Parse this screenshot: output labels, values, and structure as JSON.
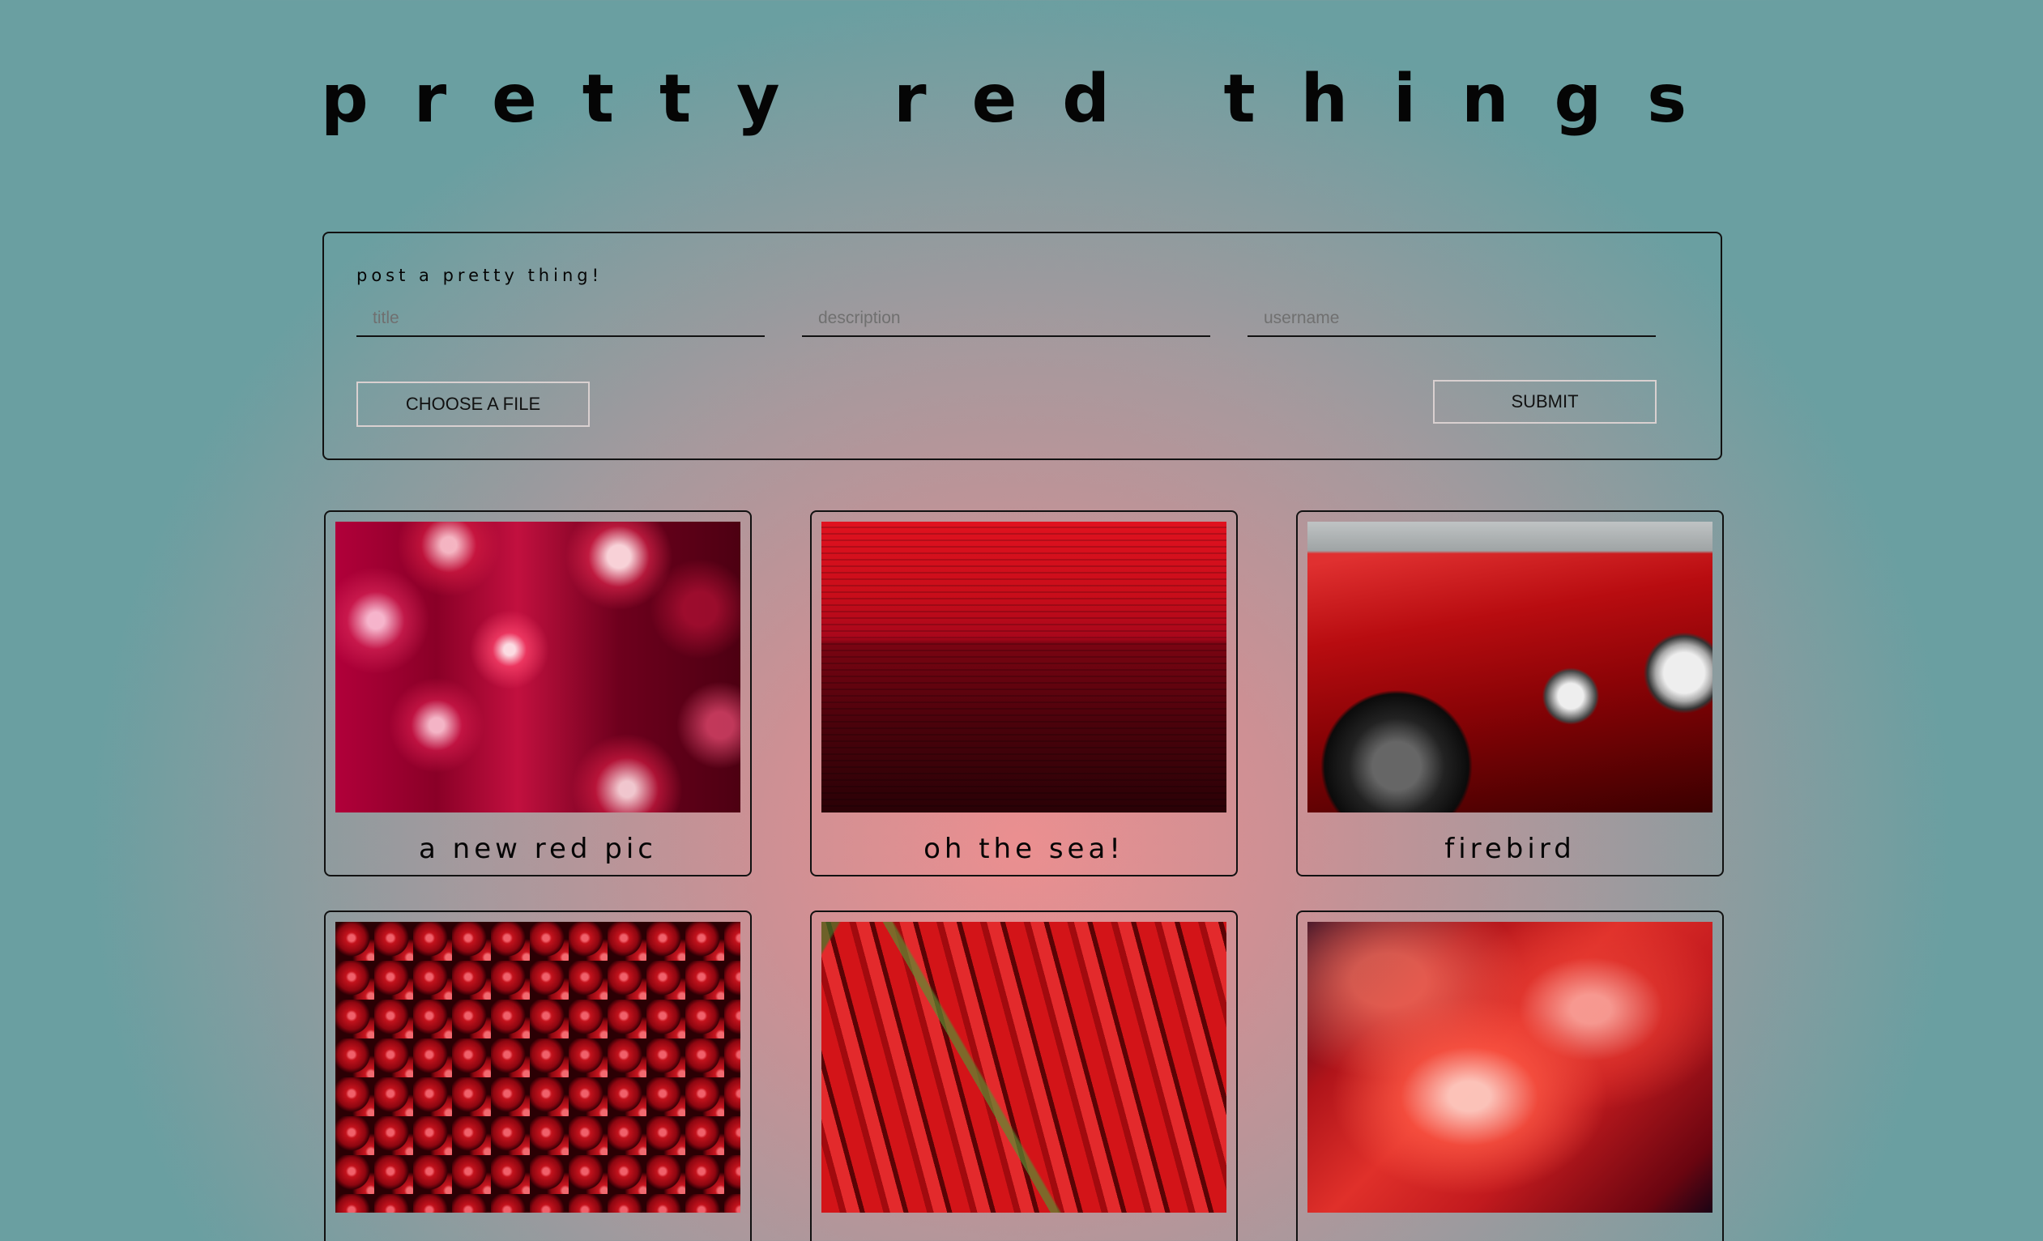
{
  "header": {
    "title": "pretty red things"
  },
  "post_form": {
    "heading": "post a pretty thing!",
    "title_placeholder": "title",
    "description_placeholder": "description",
    "username_placeholder": "username",
    "choose_file_label": "CHOOSE A FILE",
    "submit_label": "SUBMIT"
  },
  "posts": [
    {
      "caption": "a new red pic",
      "image": "red light bulbs"
    },
    {
      "caption": "oh the sea!",
      "image": "red sea"
    },
    {
      "caption": "firebird",
      "image": "red firebird car"
    },
    {
      "caption": "",
      "image": "cherries"
    },
    {
      "caption": "",
      "image": "red chili peppers"
    },
    {
      "caption": "",
      "image": "red fire"
    }
  ],
  "colors": {
    "background_center": "#eb8f90",
    "background_edge": "#6a9fa1",
    "border": "#111111",
    "button_border": "#d9d0d0"
  }
}
